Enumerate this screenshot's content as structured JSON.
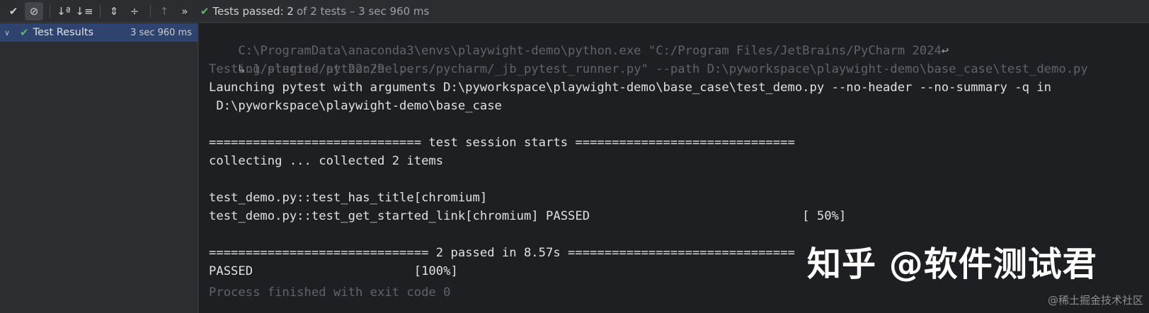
{
  "toolbar": {
    "status_label": "Tests passed:",
    "status_count": "2",
    "status_detail": "of 2 tests – 3 sec 960 ms",
    "icons": [
      "check-icon",
      "cancel-icon",
      "sort-alpha-icon",
      "sort-duration-icon",
      "expand-all-icon",
      "collapse-all-icon",
      "up-arrow-icon",
      "more-icon"
    ]
  },
  "tree": {
    "root_label": "Test Results",
    "root_time": "3 sec 960 ms"
  },
  "console": {
    "lines": [
      "C:\\ProgramData\\anaconda3\\envs\\playwight-demo\\python.exe \"C:/Program Files/JetBrains/PyCharm 2024",
      ".1/plugins/python/helpers/pycharm/_jb_pytest_runner.py\" --path D:\\pyworkspace\\playwight-demo\\base_case\\test_demo.py",
      "Testing started at 22:29 ...",
      "Launching pytest with arguments D:\\pyworkspace\\playwight-demo\\base_case\\test_demo.py --no-header --no-summary -q in",
      " D:\\pyworkspace\\playwight-demo\\base_case",
      "",
      "============================= test session starts ==============================",
      "collecting ... collected 2 items",
      "",
      "test_demo.py::test_has_title[chromium]",
      "test_demo.py::test_get_started_link[chromium] PASSED                             [ 50%]",
      "",
      "============================== 2 passed in 8.57s ===============================",
      "PASSED                      [100%]",
      "Process finished with exit code 0"
    ]
  },
  "watermark": {
    "main": "知乎 @软件测试君",
    "corner": "@稀土掘金技术社区"
  },
  "colors": {
    "accent_green": "#5fb865",
    "console_bg": "#1e1f22",
    "panel_bg": "#2b2d30",
    "selection": "#2e436e"
  }
}
